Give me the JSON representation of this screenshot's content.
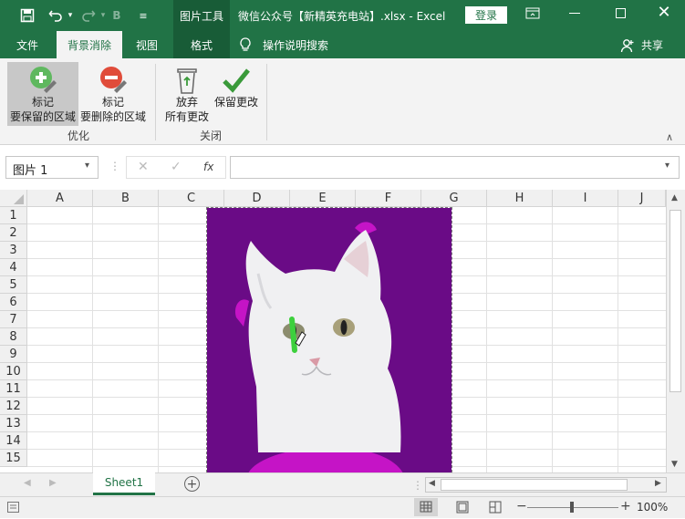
{
  "window": {
    "tool_context": "图片工具",
    "title": "微信公众号【新精英充电站】.xlsx - Excel",
    "login": "登录"
  },
  "tabs": [
    {
      "label": "文件"
    },
    {
      "label": "背景消除"
    },
    {
      "label": "视图"
    },
    {
      "label": "格式"
    }
  ],
  "tell_me": "操作说明搜索",
  "share": "共享",
  "ribbon": {
    "refine": {
      "mark_keep_l1": "标记",
      "mark_keep_l2": "要保留的区域",
      "mark_remove_l1": "标记",
      "mark_remove_l2": "要删除的区域",
      "group": "优化"
    },
    "close": {
      "discard_l1": "放弃",
      "discard_l2": "所有更改",
      "keep": "保留更改",
      "group": "关闭"
    }
  },
  "formula_bar": {
    "name_box": "图片 1",
    "fx": "fx",
    "content": ""
  },
  "columns": [
    "A",
    "B",
    "C",
    "D",
    "E",
    "F",
    "G",
    "H",
    "I",
    "J"
  ],
  "rows": [
    "1",
    "2",
    "3",
    "4",
    "5",
    "6",
    "7",
    "8",
    "9",
    "10",
    "11",
    "12",
    "13",
    "14",
    "15"
  ],
  "sheets": [
    {
      "label": "Sheet1"
    }
  ],
  "status": {
    "zoom": "100%"
  },
  "colors": {
    "excel_green": "#217346",
    "removed_area": "#6a0b86",
    "removed_magenta": "#c514c6",
    "mark_keep": "#3dd03d"
  }
}
